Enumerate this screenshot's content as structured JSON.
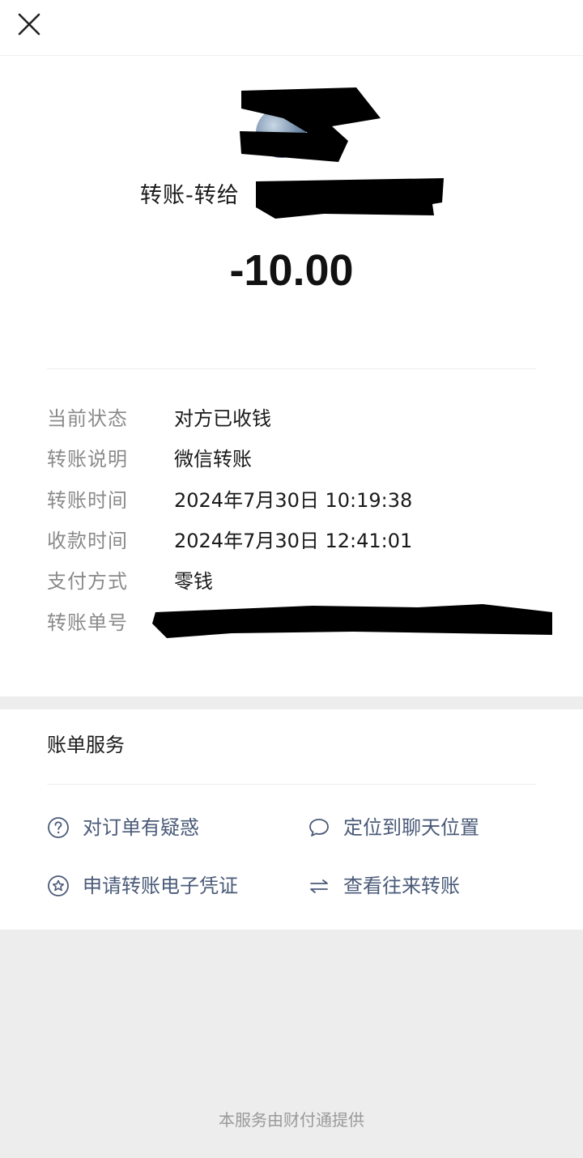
{
  "header": {
    "close_icon": "close-icon"
  },
  "transfer": {
    "title_prefix": "转账-转给",
    "amount": "-10.00"
  },
  "details": [
    {
      "label": "当前状态",
      "value": "对方已收钱"
    },
    {
      "label": "转账说明",
      "value": "微信转账"
    },
    {
      "label": "转账时间",
      "value": "2024年7月30日 10:19:38"
    },
    {
      "label": "收款时间",
      "value": "2024年7月30日 12:41:01"
    },
    {
      "label": "支付方式",
      "value": "零钱"
    },
    {
      "label": "转账单号",
      "value": ""
    }
  ],
  "services": {
    "title": "账单服务",
    "items": [
      {
        "label": "对订单有疑惑",
        "icon": "question-icon"
      },
      {
        "label": "定位到聊天位置",
        "icon": "chat-bubble-icon"
      },
      {
        "label": "申请转账电子凭证",
        "icon": "star-badge-icon"
      },
      {
        "label": "查看往来转账",
        "icon": "swap-arrows-icon"
      }
    ]
  },
  "footer": {
    "text": "本服务由财付通提供"
  },
  "colors": {
    "link": "#4a5a78",
    "label_gray": "#8a8a8a",
    "page_bg": "#ededed"
  }
}
